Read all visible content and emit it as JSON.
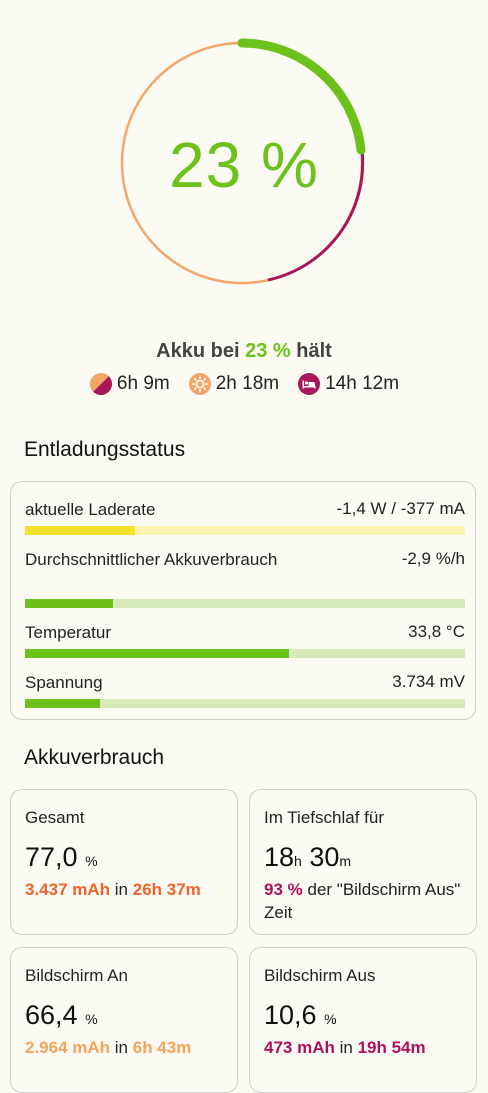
{
  "gauge": {
    "percent_text": "23 %",
    "level_fraction": 0.23,
    "colors": {
      "active": "#6cc21a",
      "screen_off": "#a8175a",
      "screen_on": "#f6a56a"
    }
  },
  "summary": {
    "prefix": "Akku bei",
    "percent": "23 %",
    "suffix": "hält",
    "times": [
      {
        "icon": "half-moon-icon",
        "value": "6h 9m"
      },
      {
        "icon": "sun-icon",
        "value": "2h 18m"
      },
      {
        "icon": "bed-icon",
        "value": "14h 12m"
      }
    ]
  },
  "discharge": {
    "title": "Entladungsstatus",
    "rows": [
      {
        "label": "aktuelle Laderate",
        "value": "-1,4 W / -377 mA",
        "fill": 0.25,
        "fill_color": "#f2e12a",
        "track_color": "#fbf3b0"
      },
      {
        "label": "Durchschnittlicher Akkuverbrauch",
        "value": "-2,9 %/h",
        "fill": 0.2,
        "fill_color": "#6cc21a",
        "track_color": "#d5eab8"
      },
      {
        "label": "Temperatur",
        "value": "33,8 °C",
        "fill": 0.6,
        "fill_color": "#6cc21a",
        "track_color": "#d5eab8"
      },
      {
        "label": "Spannung",
        "value": "3.734 mV",
        "fill": 0.17,
        "fill_color": "#6cc21a",
        "track_color": "#d5eab8"
      }
    ]
  },
  "usage": {
    "title": "Akkuverbrauch",
    "total": {
      "title": "Gesamt",
      "value": "77,0",
      "unit": "%",
      "mah": "3.437 mAh",
      "in": "in",
      "time": "26h 37m"
    },
    "deep_sleep": {
      "title": "Im Tiefschlaf für",
      "h": "18",
      "h_unit": "h",
      "m": "30",
      "m_unit": "m",
      "pct": "93 %",
      "rest": "der \"Bildschirm Aus\" Zeit"
    },
    "screen_on": {
      "title": "Bildschirm An",
      "value": "66,4",
      "unit": "%",
      "mah": "2.964 mAh",
      "in": "in",
      "time": "6h 43m"
    },
    "screen_off": {
      "title": "Bildschirm Aus",
      "value": "10,6",
      "unit": "%",
      "mah": "473 mAh",
      "in": "in",
      "time": "19h 54m"
    }
  }
}
